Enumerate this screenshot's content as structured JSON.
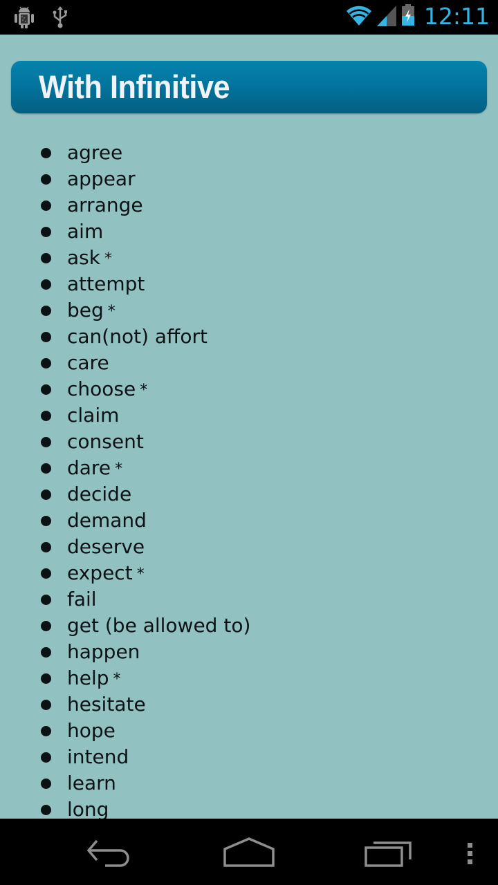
{
  "status_bar": {
    "time": "12:11",
    "left_icons": [
      "android-debug-icon",
      "usb-icon"
    ],
    "right_icons": [
      "wifi-icon",
      "signal-icon",
      "battery-charging-icon"
    ],
    "accent_color": "#33b5e5"
  },
  "header": {
    "title": "With Infinitive"
  },
  "verbs": [
    {
      "text": "agree",
      "star": ""
    },
    {
      "text": "appear",
      "star": ""
    },
    {
      "text": "arrange",
      "star": ""
    },
    {
      "text": "aim",
      "star": ""
    },
    {
      "text": "ask",
      "star": "*"
    },
    {
      "text": "attempt",
      "star": ""
    },
    {
      "text": "beg",
      "star": "*"
    },
    {
      "text": "can(not) affort",
      "star": ""
    },
    {
      "text": "care",
      "star": ""
    },
    {
      "text": "choose",
      "star": "*"
    },
    {
      "text": "claim",
      "star": ""
    },
    {
      "text": "consent",
      "star": ""
    },
    {
      "text": "dare",
      "star": "*"
    },
    {
      "text": "decide",
      "star": ""
    },
    {
      "text": "demand",
      "star": ""
    },
    {
      "text": "deserve",
      "star": ""
    },
    {
      "text": "expect",
      "star": "*"
    },
    {
      "text": "fail",
      "star": ""
    },
    {
      "text": "get (be allowed to)",
      "star": ""
    },
    {
      "text": "happen",
      "star": ""
    },
    {
      "text": "help",
      "star": "*"
    },
    {
      "text": "hesitate",
      "star": ""
    },
    {
      "text": "hope",
      "star": ""
    },
    {
      "text": "intend",
      "star": ""
    },
    {
      "text": "learn",
      "star": ""
    },
    {
      "text": "long",
      "star": ""
    }
  ],
  "nav_bar": {
    "buttons": [
      "back",
      "home",
      "recent-apps",
      "menu"
    ]
  },
  "colors": {
    "background": "#92c1c1",
    "header_top": "#0483ad",
    "header_bottom": "#035f82",
    "text": "#0b1215"
  }
}
